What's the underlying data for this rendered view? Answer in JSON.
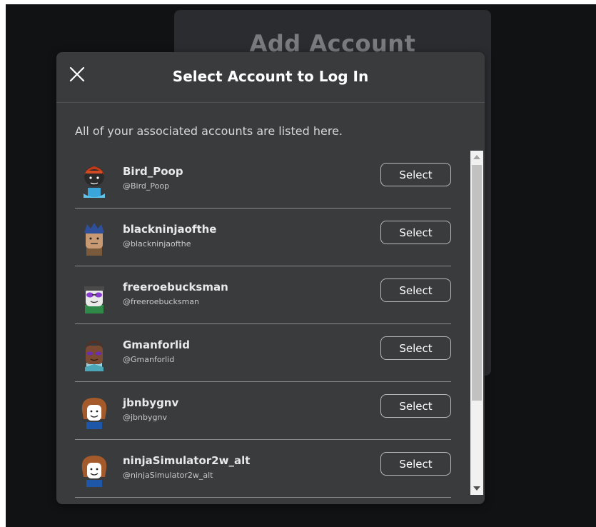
{
  "background_dialog": {
    "title": "Add Account"
  },
  "modal": {
    "title": "Select Account to Log In",
    "close_icon": "close-icon",
    "subtitle": "All of your associated accounts are listed here."
  },
  "accounts": [
    {
      "display_name": "Bird_Poop",
      "username": "@Bird_Poop",
      "button": "Select"
    },
    {
      "display_name": "blackninjaofthe",
      "username": "@blackninjaofthe",
      "button": "Select"
    },
    {
      "display_name": "freeroebucksman",
      "username": "@freeroebucksman",
      "button": "Select"
    },
    {
      "display_name": "Gmanforlid",
      "username": "@Gmanforlid",
      "button": "Select"
    },
    {
      "display_name": "jbnbygnv",
      "username": "@jbnbygnv",
      "button": "Select"
    },
    {
      "display_name": "ninjaSimulator2w_alt",
      "username": "@ninjaSimulator2w_alt",
      "button": "Select"
    }
  ],
  "colors": {
    "modal_bg": "#393b3d",
    "page_bg": "#111214",
    "text_primary": "#ffffff"
  }
}
